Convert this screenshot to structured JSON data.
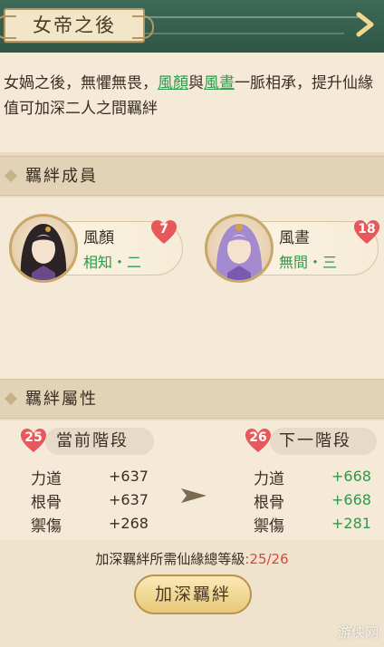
{
  "header": {
    "title": "女帝之後",
    "next_icon": "chevron-right-icon"
  },
  "description": {
    "part1": "女媧之後，無懼無畏，",
    "link1": "風顏",
    "part2": "與",
    "link2": "風晝",
    "part3": "一脈相承，提升仙緣值可加深二人之間羈絆"
  },
  "members_section": {
    "label": "羈絆成員",
    "members": [
      {
        "name": "風顏",
        "rank": "相知・二",
        "level": "7"
      },
      {
        "name": "風晝",
        "rank": "無間・三",
        "level": "18"
      }
    ]
  },
  "attributes_section": {
    "label": "羈絆屬性",
    "current": {
      "level": "25",
      "label": "當前階段",
      "stats": [
        {
          "name": "力道",
          "value": "+637"
        },
        {
          "name": "根骨",
          "value": "+637"
        },
        {
          "name": "禦傷",
          "value": "+268"
        }
      ]
    },
    "next": {
      "level": "26",
      "label": "下一階段",
      "stats": [
        {
          "name": "力道",
          "value": "+668"
        },
        {
          "name": "根骨",
          "value": "+668"
        },
        {
          "name": "禦傷",
          "value": "+281"
        }
      ]
    },
    "requirement_label": "加深羈絆所需仙緣總等級",
    "requirement_current": ":25/26",
    "deepen_button": "加深羈絆"
  },
  "watermark": "游侠网",
  "colors": {
    "header_bg": "#3e6a57",
    "accent_green": "#2e9a4c",
    "heart_red": "#e8585a",
    "requirement_red": "#d24a3c"
  }
}
